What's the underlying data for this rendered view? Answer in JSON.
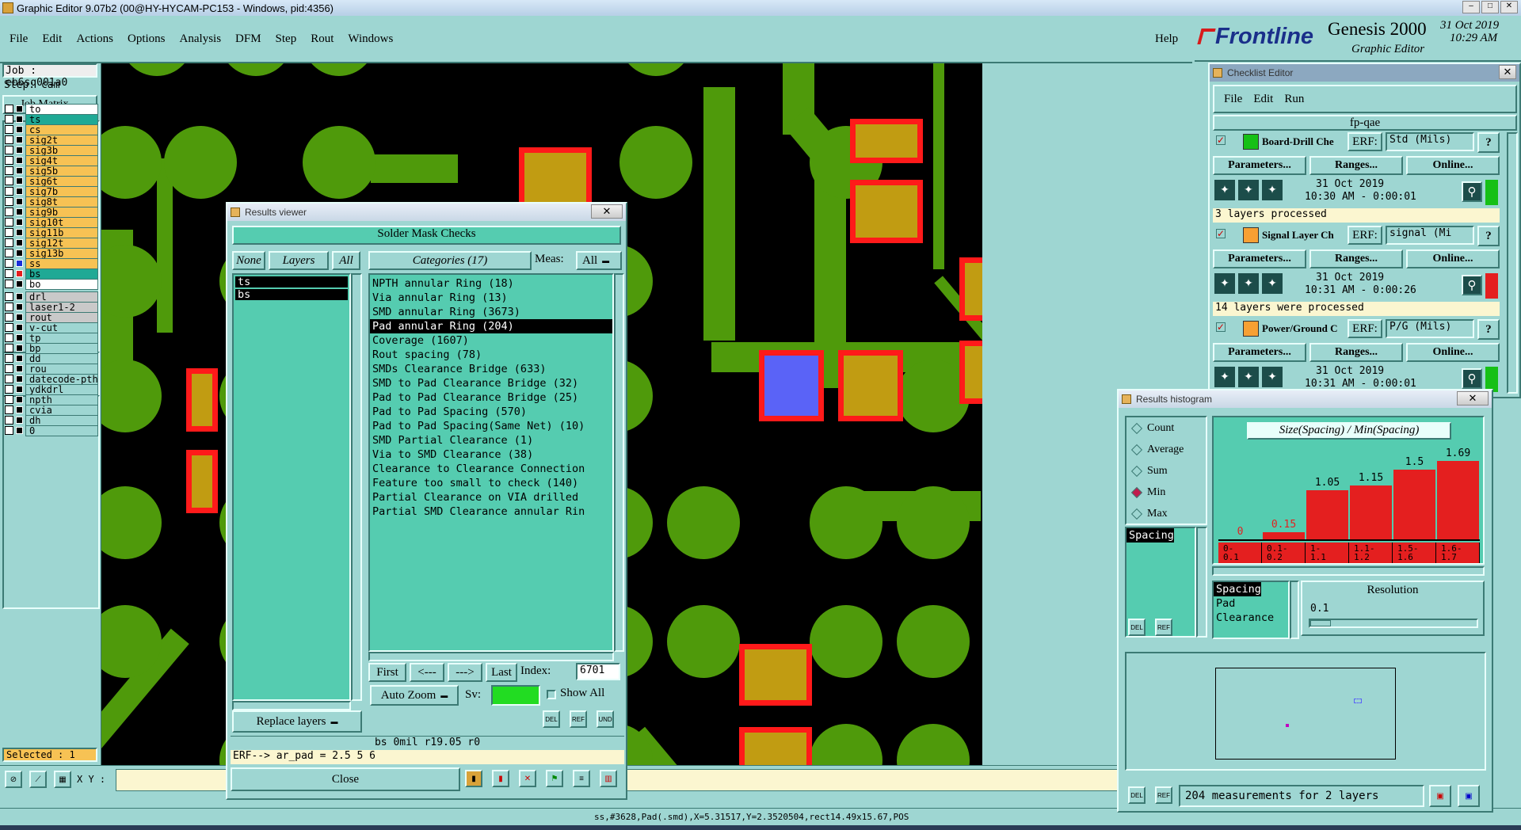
{
  "window_title": "Graphic Editor 9.07b2 (00@HY-HYCAM-PC153 - Windows, pid:4356)",
  "menu": [
    "File",
    "Edit",
    "Actions",
    "Options",
    "Analysis",
    "DFM",
    "Step",
    "Rout",
    "Windows"
  ],
  "help": "Help",
  "brand": {
    "logo": "Frontline",
    "product": "Genesis 2000",
    "subtitle": "Graphic Editor",
    "date": "31 Oct 2019",
    "time": "10:29 AM"
  },
  "job": {
    "job": "Job : eb6sq001a0",
    "step": "Step: cam",
    "matrix": "Job Matrix ..."
  },
  "layers_group1": [
    "to",
    "ts",
    "cs",
    "sig2t",
    "sig3b",
    "sig4t",
    "sig5b",
    "sig6t",
    "sig7b",
    "sig8t",
    "sig9b",
    "sig10t",
    "sig11b",
    "sig12t",
    "sig13b",
    "ss",
    "bs",
    "bo"
  ],
  "layers_group2": [
    "drl",
    "laser1-2",
    "rout"
  ],
  "layers_group3": [
    "v-cut",
    "tp",
    "bp",
    "dd",
    "rou",
    "datecode-pth",
    "ydkdrl",
    "npth",
    "cvia",
    "dh",
    "0"
  ],
  "selected": "Selected : 1",
  "xy_label": "X Y :",
  "results_viewer": {
    "title": "Results viewer",
    "header": "Solder Mask Checks",
    "btn_none": "None",
    "btn_layers": "Layers",
    "btn_all": "All",
    "categories_label": "Categories (17)",
    "meas_label": "Meas:",
    "meas_value": "All",
    "layers": [
      "ts",
      "bs"
    ],
    "categories": [
      "NPTH annular Ring (18)",
      "Via annular Ring (13)",
      "SMD annular Ring (3673)",
      "Pad annular Ring (204)",
      "Coverage (1607)",
      "Rout spacing (78)",
      "SMDs Clearance Bridge (633)",
      "SMD to Pad Clearance Bridge (32)",
      "Pad to Pad Clearance Bridge (25)",
      "Pad to Pad Spacing (570)",
      "Pad to Pad Spacing(Same Net) (10)",
      "SMD Partial Clearance (1)",
      "Via to SMD Clearance (38)",
      "Clearance to Clearance Connection",
      "Feature too small to check (140)",
      "Partial Clearance on VIA drilled",
      "Partial SMD Clearance annular Rin"
    ],
    "nav": {
      "first": "First",
      "prev": "<---",
      "next": "--->",
      "last": "Last",
      "index_label": "Index:",
      "index_value": "6701"
    },
    "auto_zoom": "Auto Zoom",
    "sv": "Sv:",
    "show_all": "Show All",
    "replace_layers": "Replace layers",
    "info": "bs 0mil  r19.05  r0",
    "erf": "ERF--> ar_pad = 2.5 5 6",
    "close": "Close"
  },
  "checklist": {
    "title": "Checklist Editor",
    "menu": [
      "File",
      "Edit",
      "Run"
    ],
    "name": "fp-qae",
    "checks": [
      {
        "name": "Board-Drill Che",
        "erf": "ERF:",
        "param": "Std (Mils)",
        "date": "31 Oct 2019",
        "time": "10:30 AM - 0:00:01",
        "msg": "3 layers processed",
        "status": "#16c016"
      },
      {
        "name": "Signal Layer Ch",
        "erf": "ERF:",
        "param": "signal (Mi",
        "date": "31 Oct 2019",
        "time": "10:31 AM - 0:00:26",
        "msg": "14 layers were processed",
        "status": "#e41f1f"
      },
      {
        "name": "Power/Ground C",
        "erf": "ERF:",
        "param": "P/G (Mils)",
        "date": "31 Oct 2019",
        "time": "10:31 AM - 0:00:01",
        "msg": "",
        "status": "#16c016"
      }
    ],
    "btn_parameters": "Parameters...",
    "btn_ranges": "Ranges...",
    "btn_online": "Online..."
  },
  "histogram": {
    "title": "Results histogram",
    "modes": [
      "Count",
      "Average",
      "Sum",
      "Min",
      "Max"
    ],
    "selected_mode": "Min",
    "measure_list": [
      "Spacing"
    ],
    "chart_title": "Size(Spacing) / Min(Spacing)",
    "bins": [
      "0-\n0.1",
      "0.1-\n0.2",
      "1-\n1.1",
      "1.1-\n1.2",
      "1.5-\n1.6",
      "1.6-\n1.7"
    ],
    "values": [
      0,
      0.15,
      1.05,
      1.15,
      1.5,
      1.69
    ],
    "value_labels": [
      "0",
      "0.15",
      "1.05",
      "1.15",
      "1.5",
      "1.69"
    ],
    "resolution_list": [
      "Spacing",
      "Pad",
      "Clearance"
    ],
    "resolution_label": "Resolution",
    "resolution_value": "0.1",
    "summary": "204 measurements for 2 layers"
  },
  "status_text": "ss,#3628,Pad(.smd),X=5.31517,Y=2.3520504,rect14.49x15.67,POS"
}
